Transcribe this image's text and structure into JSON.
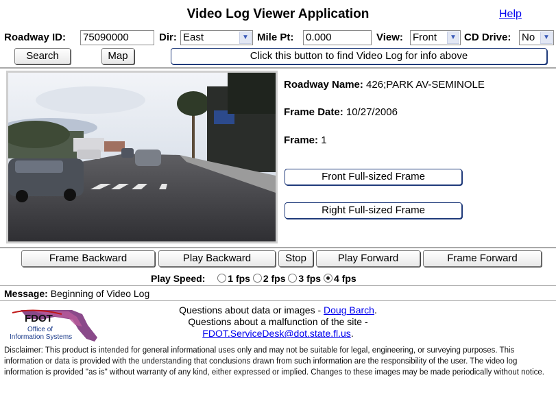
{
  "header": {
    "title": "Video Log Viewer Application",
    "help": "Help"
  },
  "params": {
    "roadway_id_label": "Roadway ID:",
    "roadway_id_value": "75090000",
    "dir_label": "Dir:",
    "dir_value": "East",
    "mile_pt_label": "Mile Pt:",
    "mile_pt_value": "0.000",
    "view_label": "View:",
    "view_value": "Front",
    "cd_drive_label": "CD Drive:",
    "cd_drive_value": "No"
  },
  "actions": {
    "search": "Search",
    "map": "Map",
    "find": "Click this button to find Video Log for info above"
  },
  "frame_info": {
    "roadway_name_label": "Roadway Name:",
    "roadway_name_value": "426;PARK AV-SEMINOLE",
    "frame_date_label": "Frame Date:",
    "frame_date_value": "10/27/2006",
    "frame_label": "Frame:",
    "frame_value": "1",
    "front_full": "Front Full-sized Frame",
    "right_full": "Right Full-sized Frame"
  },
  "controls": {
    "frame_backward": "Frame Backward",
    "play_backward": "Play Backward",
    "stop": "Stop",
    "play_forward": "Play Forward",
    "frame_forward": "Frame Forward"
  },
  "speed": {
    "label": "Play Speed:",
    "options": [
      "1 fps",
      "2 fps",
      "3 fps",
      "4 fps"
    ],
    "selected": "4 fps"
  },
  "message": {
    "label": "Message:",
    "text": "Beginning of Video Log"
  },
  "logo": {
    "text": "FDOT",
    "sub1": "Office of",
    "sub2": "Information Systems"
  },
  "contact": {
    "line1_prefix": "Questions about data or images - ",
    "line1_link": "Doug Barch",
    "line1_suffix": ".",
    "line2": "Questions about a malfunction of the site -",
    "line3_link": "FDOT.ServiceDesk@dot.state.fl.us",
    "line3_suffix": "."
  },
  "disclaimer": "Disclaimer: This product is intended for general informational uses only and may not be suitable for legal, engineering, or surveying purposes. This information or data is provided with the understanding that conclusions drawn from such information are the responsibility of the user. The video log information is provided \"as is\" without warranty of any kind, either expressed or implied. Changes to these images may be made periodically without notice.",
  "colors": {
    "link": "#0000ee",
    "button_border_blue": "#1f3a7a",
    "separator": "#a9a9a9"
  }
}
